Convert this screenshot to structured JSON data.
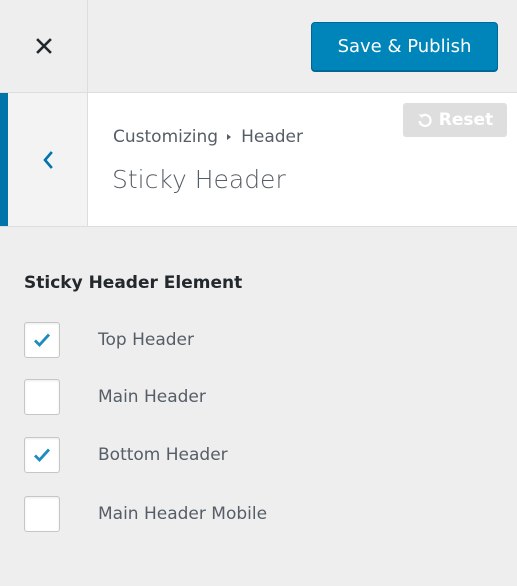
{
  "header": {
    "close_icon": "close-icon",
    "publish_label": "Save & Publish",
    "accent_color": "#0085ba"
  },
  "section": {
    "back_icon": "chevron-left-icon",
    "breadcrumb_root": "Customizing",
    "breadcrumb_current": "Header",
    "title": "Sticky Header",
    "reset_label": "Reset",
    "reset_icon": "undo-icon"
  },
  "content": {
    "group_title": "Sticky Header Element",
    "options": [
      {
        "label": "Top Header",
        "checked": true
      },
      {
        "label": "Main Header",
        "checked": false
      },
      {
        "label": "Bottom Header",
        "checked": true
      },
      {
        "label": "Main Header Mobile",
        "checked": false
      }
    ]
  }
}
